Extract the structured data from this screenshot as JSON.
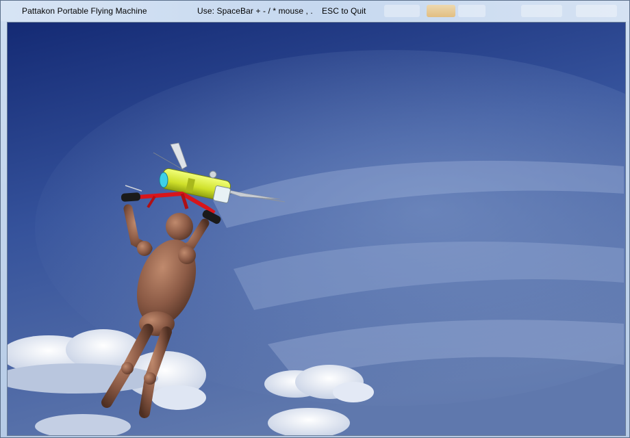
{
  "window": {
    "title": "Pattakon Portable Flying Machine",
    "help": "Use: SpaceBar + - / * mouse , .",
    "quit": "ESC to Quit"
  },
  "scene": {
    "sky_top": "#1b2f7a",
    "sky_mid": "#3e5aa0",
    "sky_bottom": "#6c84b5",
    "body_color": "#8b5a45",
    "frame_color": "#e01b1b",
    "engine_color": "#d7ef3c",
    "engine_accent": "#3ed0e8"
  }
}
